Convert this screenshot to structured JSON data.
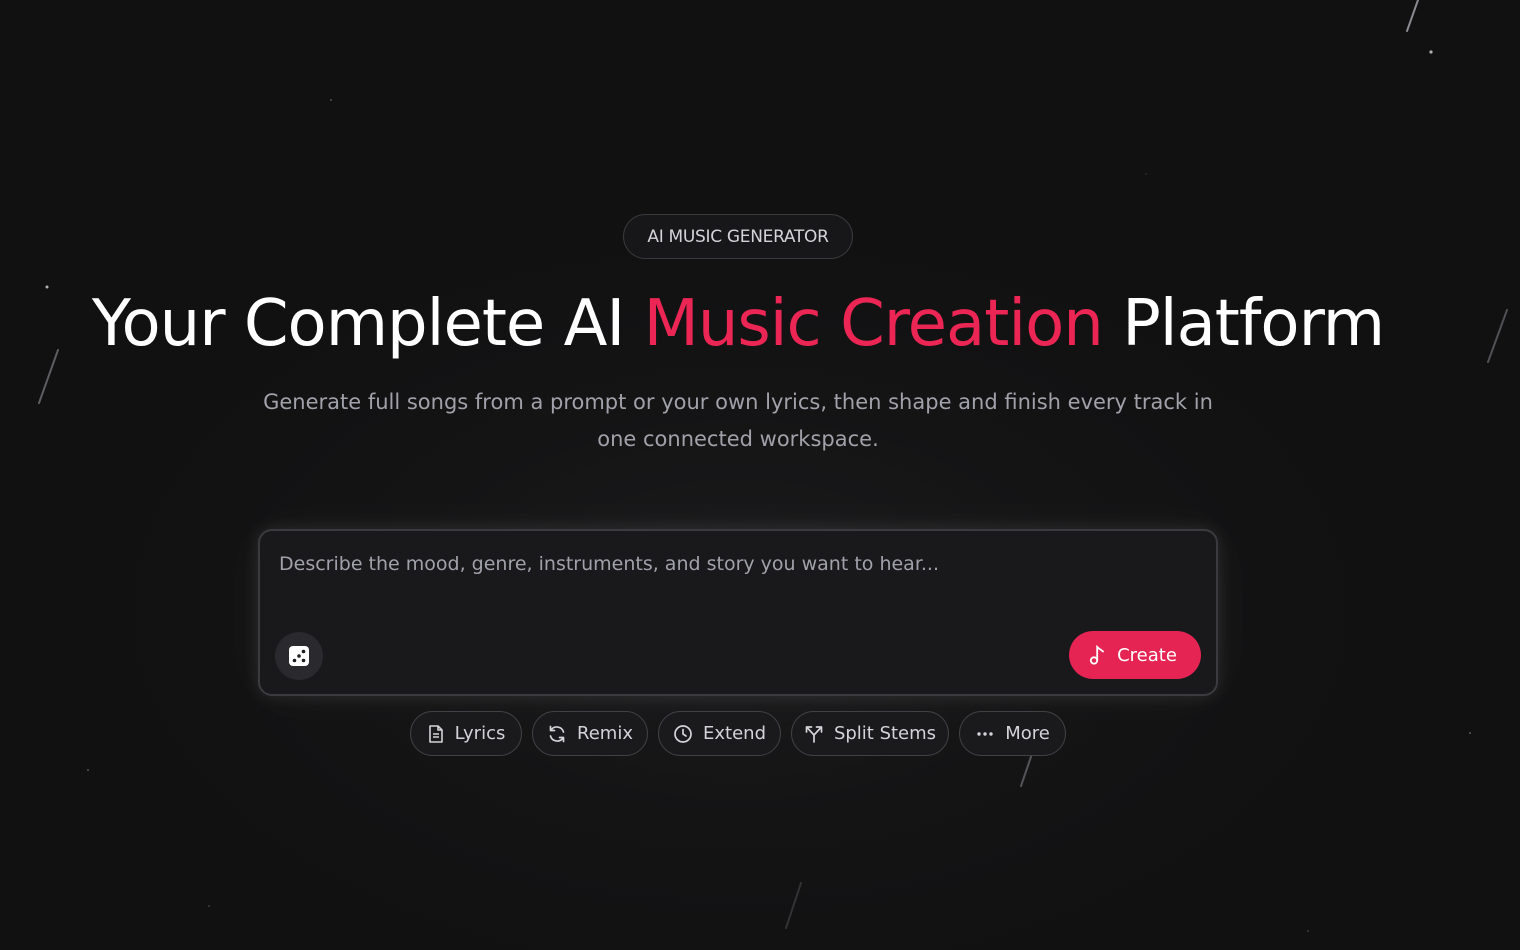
{
  "hero": {
    "badge": "AI MUSIC GENERATOR",
    "title_start": "Your Complete AI ",
    "title_accent": "Music Creation",
    "title_end": " Platform",
    "subtitle": "Generate full songs from a prompt or your own lyrics, then shape and finish every track in one connected workspace."
  },
  "composer": {
    "placeholder": "Describe the mood, genre, instruments, and story you want to hear...",
    "dice_icon": "dice-icon",
    "create_label": "Create",
    "create_icon": "music-note-icon"
  },
  "tools": [
    {
      "label": "Lyrics",
      "icon": "document-icon"
    },
    {
      "label": "Remix",
      "icon": "refresh-icon"
    },
    {
      "label": "Extend",
      "icon": "clock-icon"
    },
    {
      "label": "Split Stems",
      "icon": "split-icon"
    },
    {
      "label": "More",
      "icon": "ellipsis-icon"
    }
  ],
  "colors": {
    "background": "#111112",
    "accent": "#ec2654",
    "button": "#e52454"
  }
}
